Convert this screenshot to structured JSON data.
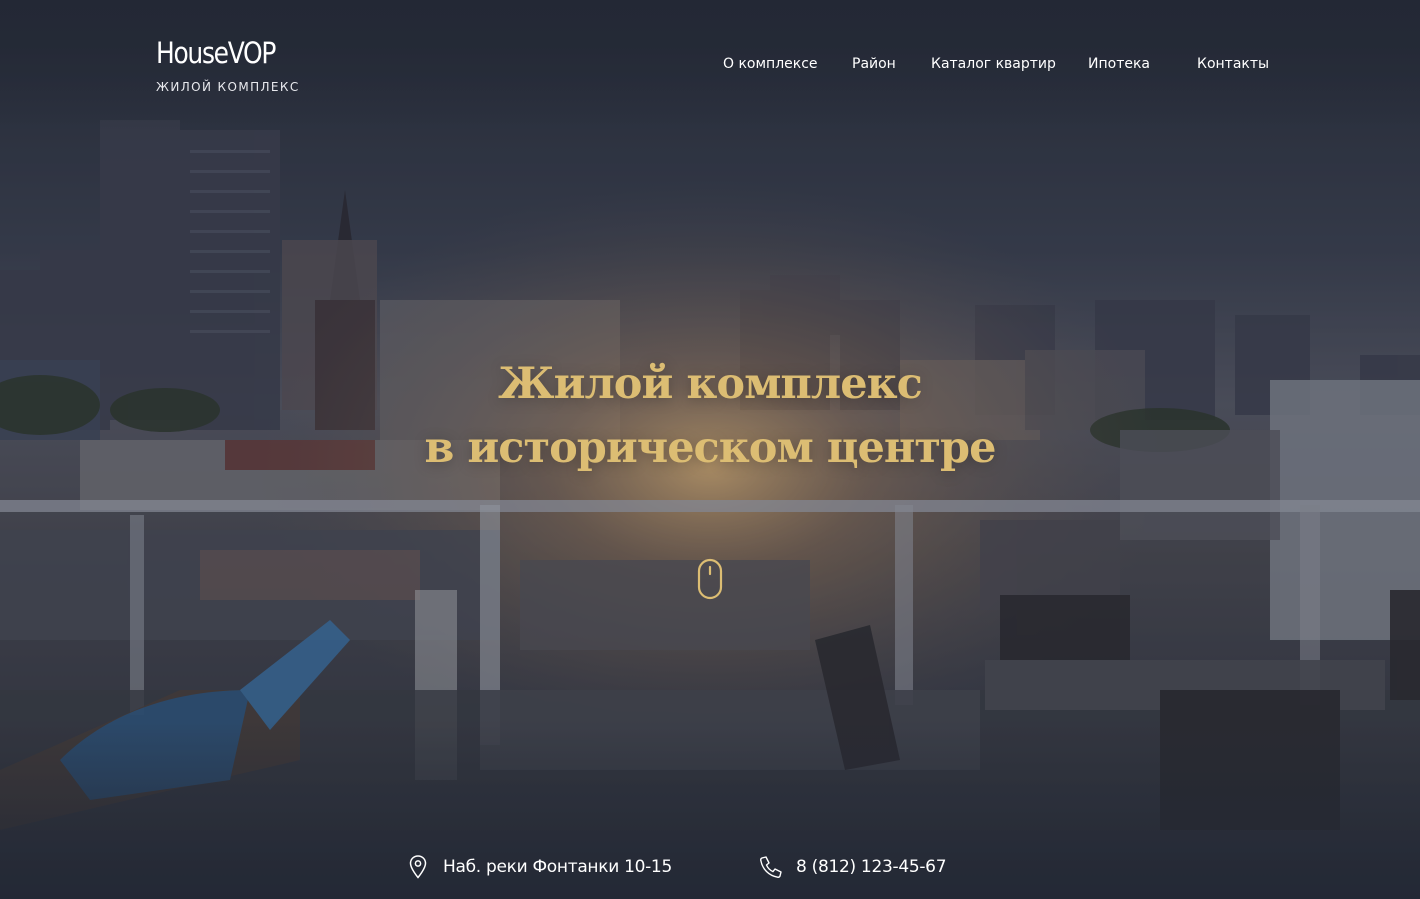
{
  "brand": {
    "name": "HouseVOP",
    "tagline": "ЖИЛОЙ КОМПЛЕКС"
  },
  "nav": {
    "items": [
      {
        "label": "О комплексе"
      },
      {
        "label": "Район"
      },
      {
        "label": "Каталог квартир"
      },
      {
        "label": "Ипотека"
      },
      {
        "label": "Контакты"
      }
    ]
  },
  "hero": {
    "headline_line1": "Жилой комплекс",
    "headline_line2": "в историческом центре",
    "scroll_icon": "mouse-icon"
  },
  "contacts": {
    "address": "Наб. реки Фонтанки 10-15",
    "address_icon": "location-pin-icon",
    "phone": "8 (812) 123-45-67",
    "phone_icon": "phone-icon"
  },
  "colors": {
    "accent_gold": "#dcbd73",
    "background_dark": "#232935",
    "text_white": "#ffffff"
  }
}
